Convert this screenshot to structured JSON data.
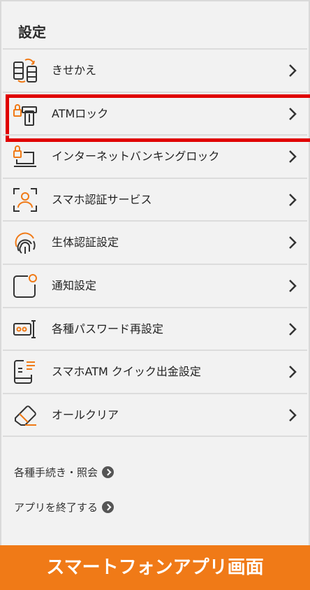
{
  "page_title": "設定",
  "menu": [
    {
      "label": "きせかえ",
      "icon": "theme-icon"
    },
    {
      "label": "ATMロック",
      "icon": "atm-lock-icon"
    },
    {
      "label": "インターネットバンキングロック",
      "icon": "internet-banking-lock-icon"
    },
    {
      "label": "スマホ認証サービス",
      "icon": "face-auth-icon"
    },
    {
      "label": "生体認証設定",
      "icon": "fingerprint-icon"
    },
    {
      "label": "通知設定",
      "icon": "notification-icon"
    },
    {
      "label": "各種パスワード再設定",
      "icon": "password-reset-icon"
    },
    {
      "label": "スマホATM クイック出金設定",
      "icon": "smartphone-atm-icon"
    },
    {
      "label": "オールクリア",
      "icon": "eraser-icon"
    }
  ],
  "links": [
    {
      "label": "各種手続き・照会"
    },
    {
      "label": "アプリを終了する"
    }
  ],
  "footer": {
    "caption": "スマートフォンアプリ画面"
  },
  "colors": {
    "accent": "#f07a17",
    "highlight": "#e00000",
    "icon_dark": "#333333"
  }
}
